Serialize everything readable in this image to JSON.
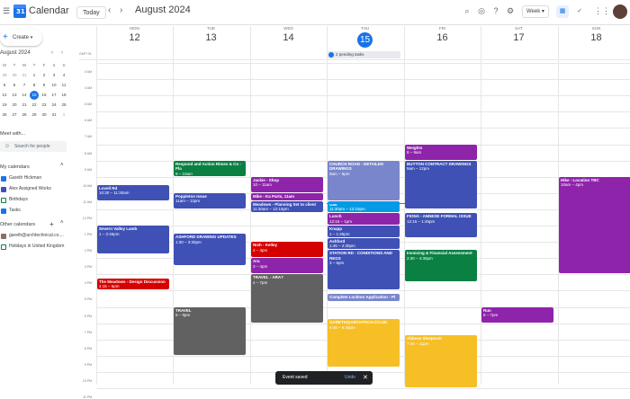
{
  "app": {
    "title": "Calendar",
    "logo_text": "31"
  },
  "header": {
    "today_label": "Today",
    "month_title": "August 2024",
    "view_label": "Week"
  },
  "mini_calendar": {
    "title": "August 2024",
    "headers": [
      "M",
      "T",
      "W",
      "T",
      "F",
      "S",
      "S"
    ],
    "rows": [
      [
        "29",
        "30",
        "31",
        "1",
        "2",
        "3",
        "4"
      ],
      [
        "5",
        "6",
        "7",
        "8",
        "9",
        "10",
        "11"
      ],
      [
        "12",
        "13",
        "14",
        "15",
        "16",
        "17",
        "18"
      ],
      [
        "19",
        "20",
        "21",
        "22",
        "23",
        "24",
        "25"
      ],
      [
        "26",
        "27",
        "28",
        "29",
        "30",
        "31",
        "1"
      ]
    ],
    "today": "15"
  },
  "sidebar": {
    "create_label": "Create",
    "meet_title": "Meet with...",
    "search_placeholder": "Search for people",
    "my_calendars_title": "My calendars",
    "my_calendars": [
      {
        "label": "Gareth Hickman",
        "color": "#1a73e8",
        "checked": true
      },
      {
        "label": "Alex Assigned Works",
        "color": "#3f51b5",
        "checked": true
      },
      {
        "label": "Birthdays",
        "color": "#0b8043",
        "checked": false
      },
      {
        "label": "Tasks",
        "color": "#1a73e8",
        "checked": true
      }
    ],
    "other_calendars_title": "Other calendars",
    "other_calendars": [
      {
        "label": "gareth@archtechnical.co....",
        "color": "#8d6e63",
        "checked": true
      },
      {
        "label": "Holidays in United Kingdom",
        "color": "#0b8043",
        "checked": false
      }
    ]
  },
  "days": [
    {
      "dow": "MON",
      "num": "12"
    },
    {
      "dow": "TUE",
      "num": "13"
    },
    {
      "dow": "WED",
      "num": "14"
    },
    {
      "dow": "THU",
      "num": "15",
      "today": true
    },
    {
      "dow": "FRI",
      "num": "16"
    },
    {
      "dow": "SAT",
      "num": "17"
    },
    {
      "dow": "SUN",
      "num": "18"
    }
  ],
  "timezone": "GMT+01",
  "hours": [
    "3 AM",
    "4 AM",
    "5 AM",
    "6 AM",
    "7 AM",
    "8 AM",
    "9 AM",
    "10 AM",
    "11 AM",
    "12 PM",
    "1 PM",
    "2 PM",
    "3 PM",
    "4 PM",
    "5 PM",
    "6 PM",
    "7 PM",
    "8 PM",
    "9 PM",
    "10 PM",
    "11 PM"
  ],
  "allday": {
    "text": "2 pending tasks"
  },
  "events": [
    {
      "title": "Lovell Rd",
      "time": "10:30 – 11:30am",
      "day": 0,
      "start": 10.5,
      "end": 11.5,
      "color": "#3f51b5"
    },
    {
      "title": "Severn Valley Lamb",
      "time": "1 – 2:45pm",
      "day": 0,
      "start": 13,
      "end": 14.75,
      "color": "#3f51b5"
    },
    {
      "title": "The Meadows - Design Discussion",
      "time": "4:15 – 5pm",
      "day": 0,
      "start": 16.25,
      "end": 17,
      "color": "#d50000"
    },
    {
      "title": "Respond and Action Rimes & Co - Pla",
      "time": "9 – 10am",
      "day": 1,
      "start": 9,
      "end": 10,
      "color": "#0b8043"
    },
    {
      "title": "Poppleton Issue",
      "time": "11am – 12pm",
      "day": 1,
      "start": 11,
      "end": 12,
      "color": "#3f51b5"
    },
    {
      "title": "ASHFORD DRAWING UPDATES",
      "time": "1:30 – 3:30pm",
      "day": 1,
      "start": 13.5,
      "end": 15.5,
      "color": "#3f51b5"
    },
    {
      "title": "TRAVEL",
      "time": "6 – 9pm",
      "day": 1,
      "start": 18,
      "end": 21,
      "color": "#616161"
    },
    {
      "title": "Jackie - Shop",
      "time": "10 – 11am",
      "day": 2,
      "start": 10,
      "end": 11,
      "color": "#8e24aa"
    },
    {
      "title": "Mike - Ka Parts, 11am",
      "time": "",
      "day": 2,
      "start": 11,
      "end": 11.5,
      "color": "#8e24aa"
    },
    {
      "title": "Meadows - Planning Set to client",
      "time": "11:30am – 12:15pm",
      "day": 2,
      "start": 11.5,
      "end": 12.25,
      "color": "#3f51b5"
    },
    {
      "title": "Nish - Kelley",
      "time": "2 – 3pm",
      "day": 2,
      "start": 14,
      "end": 15,
      "color": "#d50000"
    },
    {
      "title": "Ara",
      "time": "3 – 4pm",
      "day": 2,
      "start": 15,
      "end": 16,
      "color": "#8e24aa"
    },
    {
      "title": "TRAVEL - ARA?",
      "time": "4 – 7pm",
      "day": 2,
      "start": 16,
      "end": 19,
      "color": "#616161"
    },
    {
      "title": "CHURCH ROAD - DETAILED DRAWINGS",
      "time": "9am – 5pm",
      "day": 3,
      "start": 9,
      "end": 11.5,
      "color": "#7986cb"
    },
    {
      "title": "Gas",
      "time": "11:30am – 12:15pm",
      "day": 3,
      "start": 11.5,
      "end": 12.25,
      "color": "#039be5"
    },
    {
      "title": "Lunch",
      "time": "12:15 – 1pm",
      "day": 3,
      "start": 12.25,
      "end": 13,
      "color": "#8e24aa"
    },
    {
      "title": "Knapp",
      "time": "1 – 1:45pm",
      "day": 3,
      "start": 13,
      "end": 13.75,
      "color": "#3f51b5"
    },
    {
      "title": "Ashford",
      "time": "1:45 – 2:30pm",
      "day": 3,
      "start": 13.75,
      "end": 14.5,
      "color": "#3f51b5"
    },
    {
      "title": "STATION RD - CONDITIONS AND REGS",
      "time": "3 – 5pm",
      "day": 3,
      "start": 14.5,
      "end": 17,
      "color": "#3f51b5"
    },
    {
      "title": "Complete Lockton Application - Pl",
      "time": "",
      "day": 3,
      "start": 17.2,
      "end": 17.7,
      "color": "#7986cb"
    },
    {
      "title": "GARETH@ARCHTECH.CO.UK",
      "time": "6:45 – 9:45pm",
      "day": 3,
      "start": 18.75,
      "end": 21.75,
      "color": "#f6bf26"
    },
    {
      "title": "Weights",
      "time": "8 – 9am",
      "day": 4,
      "start": 8,
      "end": 9,
      "color": "#8e24aa"
    },
    {
      "title": "BUYTON CONTRACT DRAWINGS",
      "time": "9am – 12pm",
      "day": 4,
      "start": 9,
      "end": 12,
      "color": "#3f51b5"
    },
    {
      "title": "FIONA - ANNEXE FORMAL ISSUE",
      "time": "12:15 – 1:45pm",
      "day": 4,
      "start": 12.25,
      "end": 13.75,
      "color": "#3f51b5"
    },
    {
      "title": "Invoicing & Financial Assessment",
      "time": "2:30 – 4:30pm",
      "day": 4,
      "start": 14.5,
      "end": 16.5,
      "color": "#0b8043"
    },
    {
      "title": "Abbess Sleepover",
      "time": "7:45 – 11pm",
      "day": 4,
      "start": 19.75,
      "end": 23,
      "color": "#f6bf26"
    },
    {
      "title": "Run",
      "time": "6 – 7pm",
      "day": 5,
      "start": 18,
      "end": 19,
      "color": "#8e24aa"
    },
    {
      "title": "Hike - Location TBC",
      "time": "10am – 4pm",
      "day": 6,
      "start": 10,
      "end": 16,
      "color": "#8e24aa"
    }
  ],
  "toast": {
    "text": "Event saved",
    "undo": "Undo",
    "close": "✕"
  }
}
